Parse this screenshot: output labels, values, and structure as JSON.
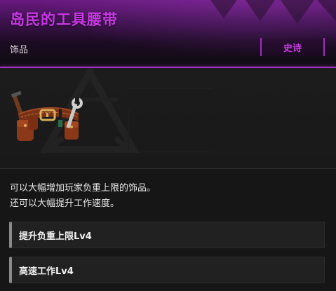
{
  "item": {
    "name": "岛民的工具腰带",
    "category": "饰品",
    "rarity": "史诗",
    "rarity_color": "#c43ee0",
    "image_icon": "tool-belt-icon",
    "description_lines": [
      "可以大幅增加玩家负重上限的饰品。",
      "还可以大幅提升工作速度。"
    ],
    "stats": [
      {
        "label": "提升负重上限Lv4"
      },
      {
        "label": "高速工作Lv4"
      }
    ]
  }
}
